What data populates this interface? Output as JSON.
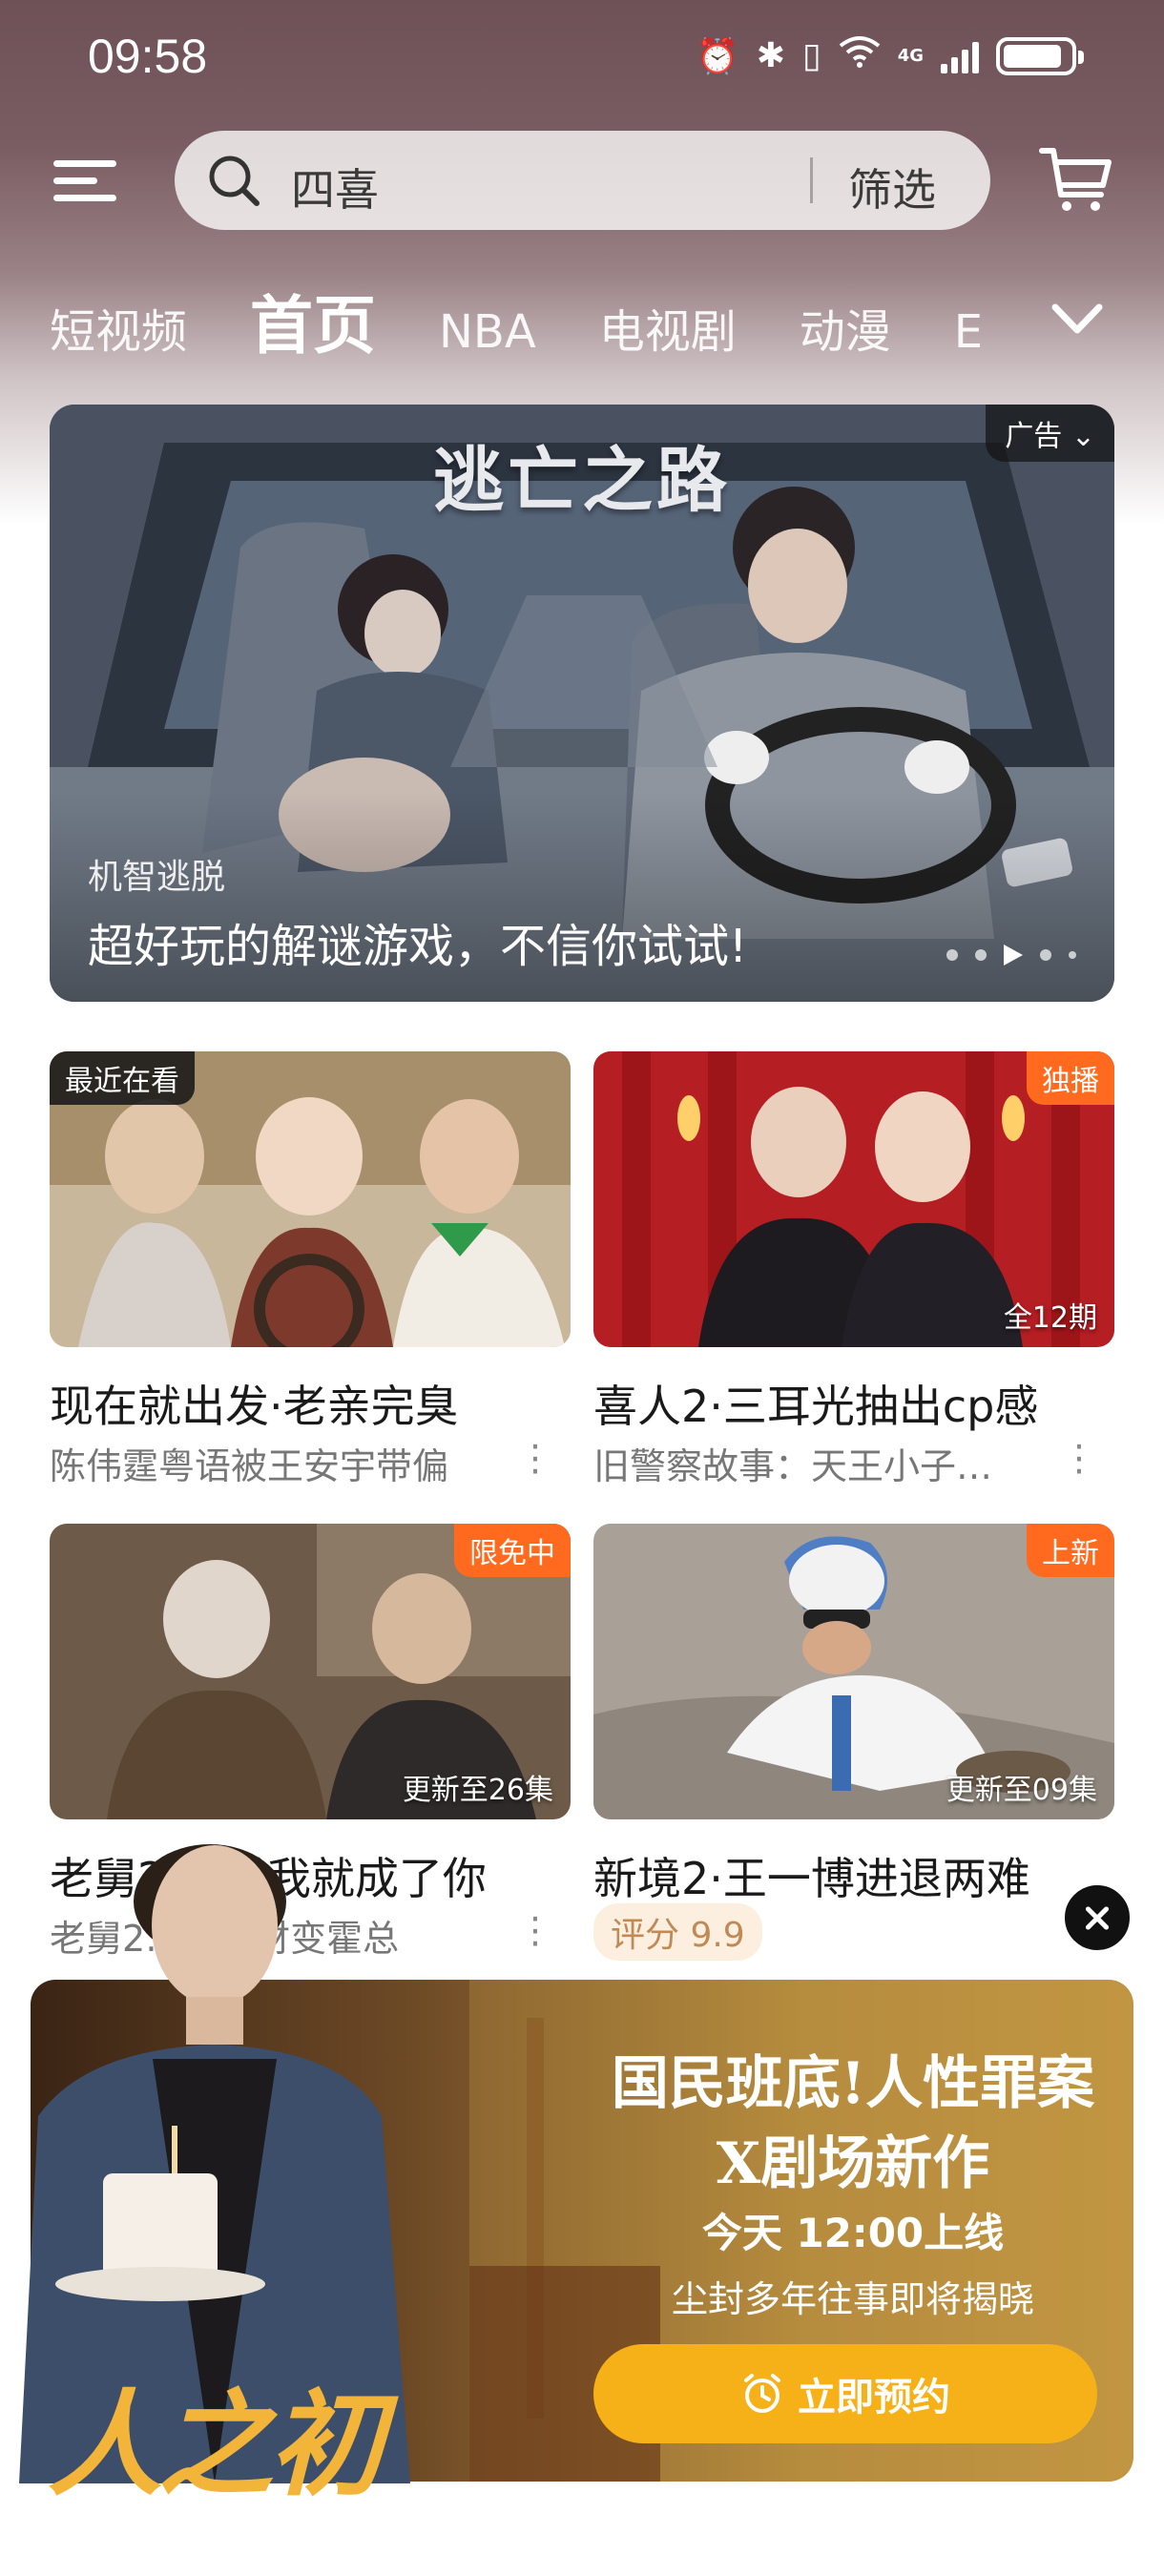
{
  "status_bar": {
    "time": "09:58",
    "network": "4G"
  },
  "header": {
    "search": {
      "query": "四喜",
      "filter_label": "筛选"
    }
  },
  "tabs": [
    {
      "label": "短视频"
    },
    {
      "label": "首页",
      "active": true
    },
    {
      "label": "NBA"
    },
    {
      "label": "电视剧"
    },
    {
      "label": "动漫"
    },
    {
      "label": "E"
    }
  ],
  "banner": {
    "title": "逃亡之路",
    "ad_label": "广告",
    "subtitle": "机智逃脱",
    "caption": "超好玩的解谜游戏，不信你试试!",
    "page_count": 5,
    "active_page": 3
  },
  "cards": [
    {
      "badge": "最近在看",
      "title": "现在就出发·老亲完臭",
      "subtitle": "陈伟霆粤语被王安宇带偏"
    },
    {
      "badge": "独播",
      "info": "全12期",
      "title": "喜人2·三耳光抽出cp感",
      "subtitle": "旧警察故事：天王小子…"
    },
    {
      "badge": "限免中",
      "info": "更新至26集",
      "title": "老舅2·…后我就成了你",
      "subtitle": "老舅2…胖发财变霍总"
    },
    {
      "badge": "上新",
      "info": "更新至09集",
      "title": "新境2·王一博进退两难",
      "rating": "评分 9.9"
    }
  ],
  "promo": {
    "line1": "国民班底!人性罪案",
    "line2": "X剧场新作",
    "time": "今天 12:00上线",
    "desc": "尘封多年往事即将揭晓",
    "button": "立即预约",
    "logo": "人之初"
  },
  "colors": {
    "accent_orange": "#ff6a1f",
    "reserve_yellow": "#f6b118",
    "rating_bg": "#fcefdf"
  }
}
